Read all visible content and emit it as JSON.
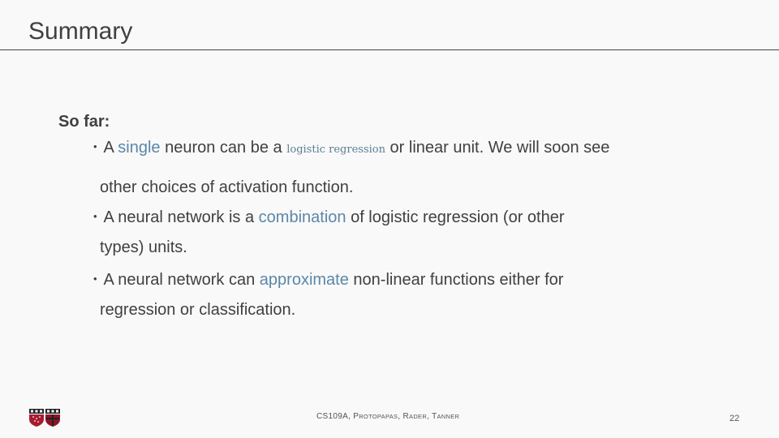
{
  "slide": {
    "title": "Summary",
    "lead": "So far:",
    "bullets": [
      {
        "parts": {
          "p1": "A ",
          "h1": "single",
          "p2": " neuron can be a ",
          "serif": "logistic regression",
          "p3": " or linear unit. We will soon see",
          "cont": "other choices of activation function."
        }
      },
      {
        "parts": {
          "p1": "A neural network is a ",
          "h1": "combination",
          "p2": " of logistic regression (or other",
          "cont": "types) units."
        }
      },
      {
        "parts": {
          "p1": "A neural network can ",
          "h1": "approximate",
          "p2": " non-linear functions either for",
          "cont": "regression or classification."
        }
      }
    ],
    "bullet_glyph": "•",
    "footer": {
      "course": "CS109A, ",
      "a1": "P",
      "a1s": "ROTOPAPAS",
      "sep1": ", ",
      "a2": "R",
      "a2s": "ADER",
      "sep2": ", ",
      "a3": "T",
      "a3s": "ANNER"
    },
    "page_number": "22",
    "colors": {
      "text": "#404040",
      "highlight": "#5b87a8",
      "background": "#f9f9f9",
      "crimson": "#a51c30"
    },
    "logo_icons": [
      "harvard-iacs-shield-icon",
      "harvard-seas-shield-icon"
    ]
  }
}
